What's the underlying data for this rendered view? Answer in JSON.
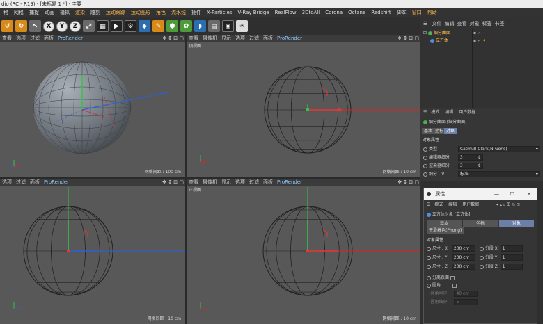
{
  "title": "dio (RC - R19) - [未标题 1 *] - 主要",
  "menu": [
    {
      "label": "格",
      "hl": false
    },
    {
      "label": "网格",
      "hl": false
    },
    {
      "label": "捕捉",
      "hl": false
    },
    {
      "label": "动画",
      "hl": false
    },
    {
      "label": "模拟",
      "hl": false
    },
    {
      "label": "渲染",
      "hl": true
    },
    {
      "label": "雕刻",
      "hl": false
    },
    {
      "label": "运动跟踪",
      "hl": true
    },
    {
      "label": "运动图形",
      "hl": true
    },
    {
      "label": "角色",
      "hl": true
    },
    {
      "label": "流水线",
      "hl": true
    },
    {
      "label": "插件",
      "hl": false
    },
    {
      "label": "X-Particles",
      "hl": false
    },
    {
      "label": "V-Ray Bridge",
      "hl": false
    },
    {
      "label": "RealFlow",
      "hl": false
    },
    {
      "label": "3DtoAll",
      "hl": false
    },
    {
      "label": "Corona",
      "hl": false
    },
    {
      "label": "Octane",
      "hl": false
    },
    {
      "label": "Redshift",
      "hl": false
    },
    {
      "label": "脚本",
      "hl": false
    },
    {
      "label": "窗口",
      "hl": true
    },
    {
      "label": "帮助",
      "hl": true
    }
  ],
  "toolbar": {
    "x": "X",
    "y": "Y",
    "z": "Z"
  },
  "viewports": {
    "tl": {
      "menu": [
        "查看",
        "选项",
        "过滤",
        "面板",
        "ProRender"
      ],
      "name": "",
      "grid": "网格间距 : 100 cm"
    },
    "tr": {
      "menu": [
        "查看",
        "摄像机",
        "显示",
        "选项",
        "过滤",
        "面板",
        "ProRender"
      ],
      "name": "顶视图",
      "grid": "网格间距 : 10 cm"
    },
    "bl": {
      "menu": [
        "选项",
        "过滤",
        "面板",
        "ProRender"
      ],
      "name": "",
      "grid": "网格间距 : 10 cm"
    },
    "br": {
      "menu": [
        "查看",
        "摄像机",
        "显示",
        "选项",
        "过滤",
        "面板",
        "ProRender"
      ],
      "name": "正视图",
      "grid": "网格间距 : 10 cm"
    }
  },
  "objects": {
    "tabs": [
      "文件",
      "编辑",
      "查看",
      "对象",
      "标签",
      "书签"
    ],
    "items": [
      "细分曲面",
      "立方体"
    ]
  },
  "attributes": {
    "tabs": [
      "模式",
      "编辑",
      "用户数据"
    ],
    "object_title": "细分曲面 [细分曲面]",
    "subtabs": [
      "基本",
      "坐标",
      "对象"
    ],
    "section": "对象属性",
    "rows": [
      {
        "label": "类型",
        "value": "Catmull-Clark(N-Gons)"
      },
      {
        "label": "编辑器细分",
        "value": "3"
      },
      {
        "label": "渲染器细分",
        "value": "3"
      },
      {
        "label": "细分 UV",
        "value": "标准"
      }
    ]
  },
  "dialog": {
    "title": "属性",
    "tabs": [
      "模式",
      "编辑",
      "用户数据"
    ],
    "object_title": "立方体对象 [立方体]",
    "subtabs": [
      "基本",
      "坐标",
      "对象"
    ],
    "phong": "平滑着色(Phong)",
    "section": "对象属性",
    "size_rows": [
      {
        "label": "尺寸 . X",
        "value": "200 cm",
        "seg_label": "分段 X",
        "seg": "1"
      },
      {
        "label": "尺寸 . Y",
        "value": "200 cm",
        "seg_label": "分段 Y",
        "seg": "1"
      },
      {
        "label": "尺寸 . Z",
        "value": "200 cm",
        "seg_label": "分段 Z",
        "seg": "1"
      }
    ],
    "sep_faces": "分离表面",
    "fillet": "圆角 . . . .",
    "fillet_radius": "圆角半径",
    "fillet_radius_val": "40 cm",
    "fillet_sub": "圆角细分",
    "fillet_sub_val": "5"
  }
}
